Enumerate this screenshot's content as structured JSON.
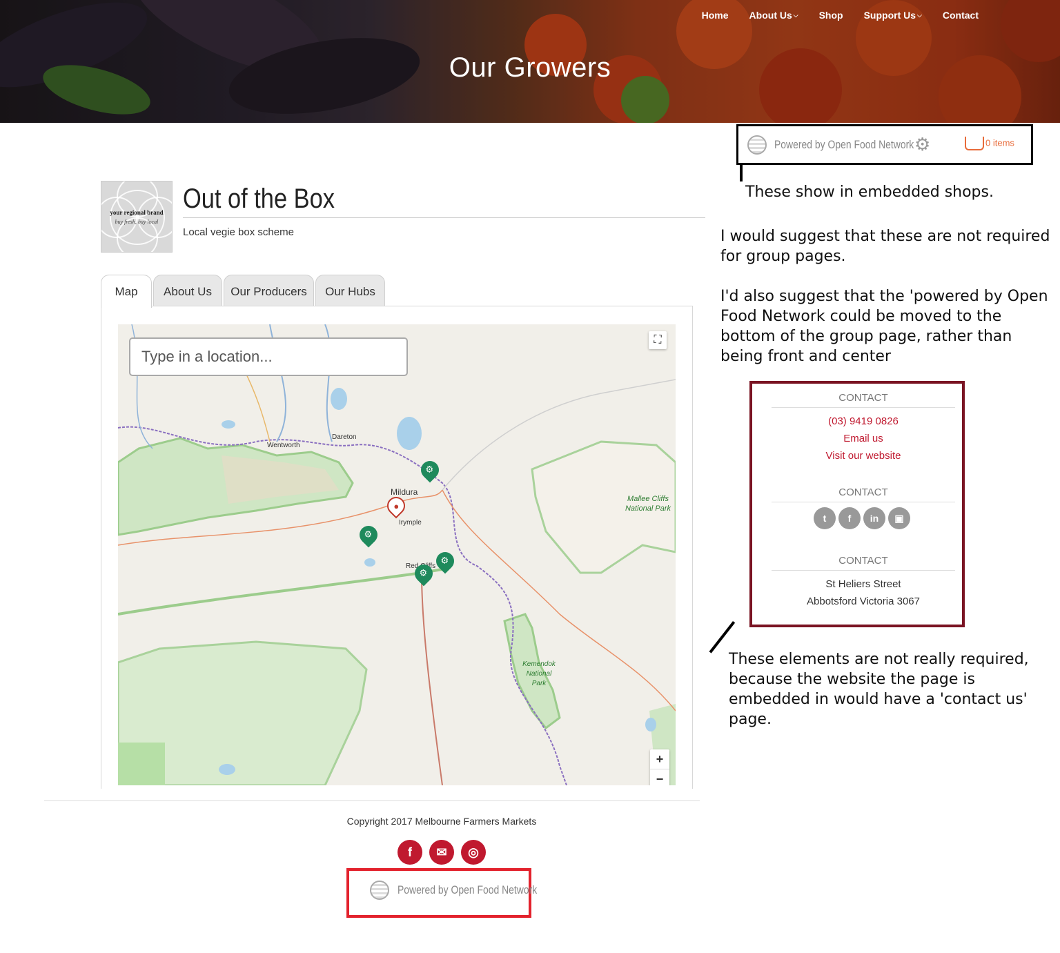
{
  "nav": {
    "items": [
      {
        "label": "Home",
        "dropdown": false
      },
      {
        "label": "About Us",
        "dropdown": true
      },
      {
        "label": "Shop",
        "dropdown": false
      },
      {
        "label": "Support Us",
        "dropdown": true
      },
      {
        "label": "Contact",
        "dropdown": false
      }
    ]
  },
  "banner": {
    "title": "Our Growers"
  },
  "ofn_top": {
    "powered_by": "Powered by Open Food Network",
    "cart_label": "0 items"
  },
  "group": {
    "logo_line1": "your regional brand",
    "logo_line2": "buy fresh, buy local",
    "name": "Out of the Box",
    "description": "Local vegie box scheme"
  },
  "tabs": [
    {
      "label": "Map",
      "active": true
    },
    {
      "label": "About Us",
      "active": false
    },
    {
      "label": "Our Producers",
      "active": false
    },
    {
      "label": "Our Hubs",
      "active": false
    }
  ],
  "map": {
    "search_placeholder": "Type in a location...",
    "zoom_in": "+",
    "zoom_out": "−",
    "places": [
      "Dareton",
      "Wentworth",
      "Mildura",
      "Irymple",
      "Red Cliffs"
    ],
    "parks": [
      "Mallee Cliffs National Park",
      "Kemendok National Park"
    ]
  },
  "annotations": {
    "top_note": "These show in embedded shops.",
    "suggest_1": "I would suggest that these are not required for group pages.",
    "suggest_2": "I'd also suggest that the 'powered by Open Food Network could be moved to the bottom of the group page, rather than being front and center",
    "bottom_note": "These elements are not really required, because the website the page is embedded in would have a 'contact us' page."
  },
  "contact": {
    "heading_1": "CONTACT",
    "phone": "(03) 9419 0826",
    "email": "Email us",
    "website": "Visit our website",
    "heading_2": "CONTACT",
    "heading_3": "CONTACT",
    "address_1": "St Heliers Street",
    "address_2": "Abbotsford Victoria 3067"
  },
  "footer": {
    "copyright": "Copyright 2017 Melbourne Farmers Markets",
    "powered_by": "Powered by Open Food Network"
  },
  "colors": {
    "brand_red": "#c0192f",
    "annotation_box_dark_red": "#7a1423",
    "annotation_box_red": "#e3222d",
    "producer_pin_green": "#1e8a5c",
    "cart_orange": "#e86b3a"
  }
}
